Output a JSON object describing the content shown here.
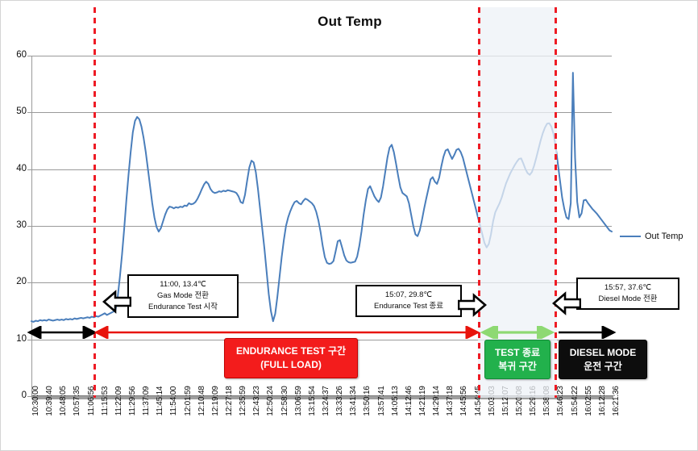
{
  "chart_data": {
    "type": "line",
    "title": "Out Temp",
    "xlabel": "",
    "ylabel": "",
    "ylim": [
      0,
      60
    ],
    "ytick_step": 10,
    "grid": true,
    "legend_position": "right",
    "series": [
      {
        "name": "Out Temp",
        "color": "#4a7ebb",
        "values": [
          13.2,
          13.1,
          13.3,
          13.2,
          13.4,
          13.3,
          13.4,
          13.3,
          13.5,
          13.4,
          13.3,
          13.4,
          13.5,
          13.4,
          13.5,
          13.4,
          13.6,
          13.5,
          13.6,
          13.5,
          13.7,
          13.6,
          13.7,
          13.8,
          13.7,
          13.8,
          13.9,
          13.8,
          14.0,
          13.9,
          14.1,
          14.0,
          14.2,
          14.4,
          14.6,
          14.3,
          14.5,
          14.7,
          14.9,
          15.2,
          17.5,
          21.0,
          25.0,
          29.5,
          34.5,
          39.0,
          43.0,
          46.5,
          48.5,
          49.2,
          48.8,
          47.5,
          45.5,
          43.0,
          40.0,
          37.0,
          34.0,
          31.5,
          29.8,
          29.0,
          29.6,
          30.8,
          32.0,
          32.9,
          33.4,
          33.3,
          33.1,
          33.3,
          33.2,
          33.4,
          33.3,
          33.6,
          33.5,
          34.0,
          33.8,
          33.9,
          34.2,
          34.8,
          35.6,
          36.5,
          37.3,
          37.8,
          37.4,
          36.5,
          36.0,
          35.8,
          35.9,
          36.1,
          36.0,
          36.2,
          36.1,
          36.3,
          36.2,
          36.1,
          36.0,
          35.8,
          35.2,
          34.2,
          34.0,
          35.5,
          38.0,
          40.3,
          41.5,
          41.2,
          39.5,
          36.5,
          33.0,
          29.5,
          26.0,
          22.0,
          18.0,
          15.0,
          13.2,
          14.5,
          17.5,
          21.0,
          24.5,
          27.5,
          30.0,
          31.5,
          32.6,
          33.5,
          34.2,
          34.4,
          34.0,
          33.8,
          34.4,
          34.8,
          34.6,
          34.3,
          34.0,
          33.5,
          32.5,
          31.0,
          29.0,
          26.5,
          24.5,
          23.5,
          23.3,
          23.4,
          23.8,
          25.5,
          27.3,
          27.5,
          26.2,
          24.8,
          23.9,
          23.6,
          23.5,
          23.6,
          23.7,
          24.6,
          26.5,
          29.0,
          32.0,
          34.5,
          36.5,
          37.0,
          36.1,
          35.2,
          34.6,
          34.2,
          35.0,
          37.0,
          39.5,
          42.0,
          43.8,
          44.3,
          43.0,
          41.0,
          38.8,
          36.8,
          35.8,
          35.5,
          35.2,
          34.0,
          32.0,
          30.0,
          28.5,
          28.2,
          29.2,
          31.0,
          33.0,
          34.8,
          36.5,
          38.2,
          38.6,
          37.8,
          37.4,
          38.5,
          40.5,
          42.2,
          43.3,
          43.5,
          42.6,
          41.8,
          42.5,
          43.4,
          43.6,
          43.0,
          42.0,
          40.5,
          39.0,
          37.5,
          36.0,
          34.5,
          33.0,
          31.5,
          30.0,
          28.5,
          27.0,
          26.2,
          26.8,
          28.5,
          30.8,
          32.4,
          33.2,
          34.0,
          35.0,
          36.3,
          37.5,
          38.4,
          39.3,
          40.0,
          40.7,
          41.3,
          41.8,
          41.9,
          41.0,
          40.0,
          39.3,
          39.0,
          39.5,
          40.6,
          42.0,
          43.5,
          45.0,
          46.3,
          47.3,
          48.0,
          48.1,
          47.5,
          46.2,
          44.0,
          41.0,
          38.0,
          35.0,
          33.0,
          31.5,
          31.2,
          34.0,
          57.0,
          42.0,
          34.2,
          31.5,
          32.2,
          34.5,
          34.6,
          34.0,
          33.5,
          33.0,
          32.6,
          32.2,
          31.7,
          31.2,
          30.7,
          30.2,
          29.7,
          29.2,
          29.0
        ]
      }
    ],
    "x_tick_labels": [
      "10:30:00",
      "10:39:40",
      "10:48:05",
      "10:57:35",
      "11:06:56",
      "11:15:53",
      "11:22:09",
      "11:29:56",
      "11:37:09",
      "11:45:14",
      "11:54:00",
      "12:01:59",
      "12:10:48",
      "12:19:09",
      "12:27:18",
      "12:35:59",
      "12:43:23",
      "12:50:24",
      "12:58:30",
      "13:06:59",
      "13:15:54",
      "13:24:37",
      "13:33:26",
      "13:41:34",
      "13:50:16",
      "13:57:41",
      "14:05:13",
      "14:12:46",
      "14:21:19",
      "14:29:14",
      "14:37:18",
      "14:45:56",
      "14:54:45",
      "15:03:03",
      "15:12:07",
      "15:20:08",
      "15:29:16",
      "15:38:08",
      "15:46:23",
      "15:54:22",
      "16:02:55",
      "16:12:28",
      "16:21:36"
    ],
    "y_tick_labels": [
      "0",
      "10",
      "20",
      "30",
      "40",
      "50",
      "60"
    ]
  },
  "legend": {
    "series_label": "Out Temp"
  },
  "markers": {
    "vline_color": "#ee1c25",
    "lines": [
      {
        "name": "gas-mode-start",
        "time": "11:00"
      },
      {
        "name": "endurance-end",
        "time": "15:07"
      },
      {
        "name": "diesel-mode-start",
        "time": "15:57"
      }
    ]
  },
  "callouts": [
    {
      "name": "callout-gas-mode",
      "lines": [
        "11:00, 13.4℃",
        "Gas Mode 전환",
        "Endurance Test 시작"
      ]
    },
    {
      "name": "callout-endurance-end",
      "lines": [
        "15:07, 29.8℃",
        "Endurance Test 종료"
      ]
    },
    {
      "name": "callout-diesel-mode",
      "lines": [
        "15:57, 37.6℃",
        "Diesel Mode 전환"
      ]
    }
  ],
  "regions": [
    {
      "name": "region-endurance",
      "lines": [
        "ENDURANCE TEST 구간",
        "(FULL LOAD)"
      ],
      "color": "#f31c1c"
    },
    {
      "name": "region-return",
      "lines": [
        "TEST 종료",
        "복귀 구간"
      ],
      "color": "#22b14c"
    },
    {
      "name": "region-diesel",
      "lines": [
        "DIESEL MODE",
        "운전 구간"
      ],
      "color": "#0d0d0d"
    }
  ]
}
